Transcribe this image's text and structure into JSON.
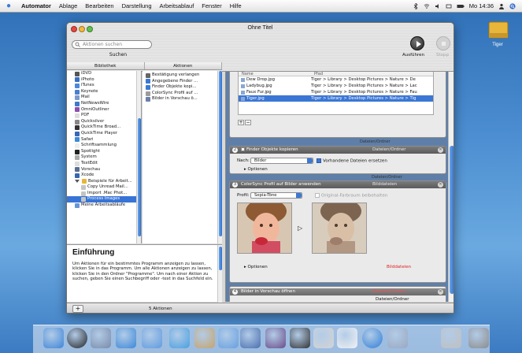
{
  "menubar": {
    "app": "Automator",
    "items": [
      "Ablage",
      "Bearbeiten",
      "Darstellung",
      "Arbeitsablauf",
      "Fenster",
      "Hilfe"
    ],
    "clock": "Mo 14:36"
  },
  "desktop": {
    "disk_label": "Tiger"
  },
  "window": {
    "title": "Ohne Titel",
    "search_placeholder": "Aktionen suchen",
    "search_label": "Suchen",
    "run_label": "Ausführen",
    "stop_label": "Stopp",
    "col_library": "Bibliothek",
    "col_actions": "Aktionen"
  },
  "library": [
    {
      "label": "iDVD",
      "color": "#555"
    },
    {
      "label": "iPhoto",
      "color": "#3a6fc0"
    },
    {
      "label": "iTunes",
      "color": "#4b88d8"
    },
    {
      "label": "Keynote",
      "color": "#4a7fd0"
    },
    {
      "label": "Mail",
      "color": "#7a9bcc"
    },
    {
      "label": "NetNewsWire",
      "color": "#3f79c9"
    },
    {
      "label": "OmniOutliner",
      "color": "#8c4fb0"
    },
    {
      "label": "PDF",
      "color": "#ddd"
    },
    {
      "label": "Quicksilver",
      "color": "#888"
    },
    {
      "label": "QuickTime Broad...",
      "color": "#333"
    },
    {
      "label": "QuickTime Player",
      "color": "#3a66b8"
    },
    {
      "label": "Safari",
      "color": "#3c8ad8"
    },
    {
      "label": "Schriftsammlung",
      "color": "#eee"
    },
    {
      "label": "Spotlight",
      "color": "#222"
    },
    {
      "label": "System",
      "color": "#aaa"
    },
    {
      "label": "TextEdit",
      "color": "#ddd"
    },
    {
      "label": "Vorschau",
      "color": "#5b6e8f"
    },
    {
      "label": "Xcode",
      "color": "#3966b0"
    }
  ],
  "library_group": {
    "label": "Beispiele für Arbeit...",
    "children": [
      "Copy Unread Mail...",
      "Import .Mac Phot...",
      "Process Images"
    ]
  },
  "library_footer": "Meine Arbeitsabläufe",
  "actions": [
    "Bestätigung verlangen",
    "Angegebene Finder ...",
    "Finder Objekte kopi...",
    "ColorSync Profil auf ...",
    "Bilder in Vorschau ö..."
  ],
  "description": {
    "title": "Einführung",
    "text": "Um Aktionen für ein bestimmtes Programm anzeigen zu lassen, klicken Sie in das Programm. Um alle Aktionen anzeigen zu lassen, klicken Sie in den Ordner \"Programme\". Um nach einer Aktion zu suchen, geben Sie einen Suchbegriff oder -text in das Suchfeld ein."
  },
  "footer": {
    "count": "5 Aktionen"
  },
  "workflow": {
    "files_header": {
      "name": "Name",
      "path": "Pfad"
    },
    "files": [
      {
        "name": "Dew Drop.jpg",
        "path": "Tiger > Library > Desktop Pictures > Nature > De"
      },
      {
        "name": "Ladybug.jpg",
        "path": "Tiger > Library > Desktop Pictures > Nature > Lac"
      },
      {
        "name": "Faux Fur.jpg",
        "path": "Tiger > Library > Desktop Pictures > Nature > Fau"
      },
      {
        "name": "Tiger.jpg",
        "path": "Tiger > Library > Desktop Pictures > Nature > Tig"
      }
    ],
    "conn1": "Dateien/Ordner",
    "action2": {
      "num": "2",
      "title": "Finder Objekte kopieren",
      "io": "Dateien/Ordner",
      "nach_label": "Nach:",
      "folder": "Bilder",
      "replace": "Vorhandene Dateien ersetzen",
      "options": "Optionen",
      "out": "Dateien/Ordner"
    },
    "action3": {
      "num": "3",
      "title": "ColorSync Profil auf Bilder anwenden",
      "io": "Bilddateien",
      "profil_label": "Profil:",
      "profil": "Sepia-Töne",
      "keep": "Original-Farbraum beibehalten",
      "options": "Optionen",
      "out": "Bilddateien"
    },
    "action4": {
      "num": "4",
      "title": "Bilder in Vorschau öffnen",
      "io": "Dateien/Ordner",
      "out": "Dateien/Ordner"
    }
  }
}
